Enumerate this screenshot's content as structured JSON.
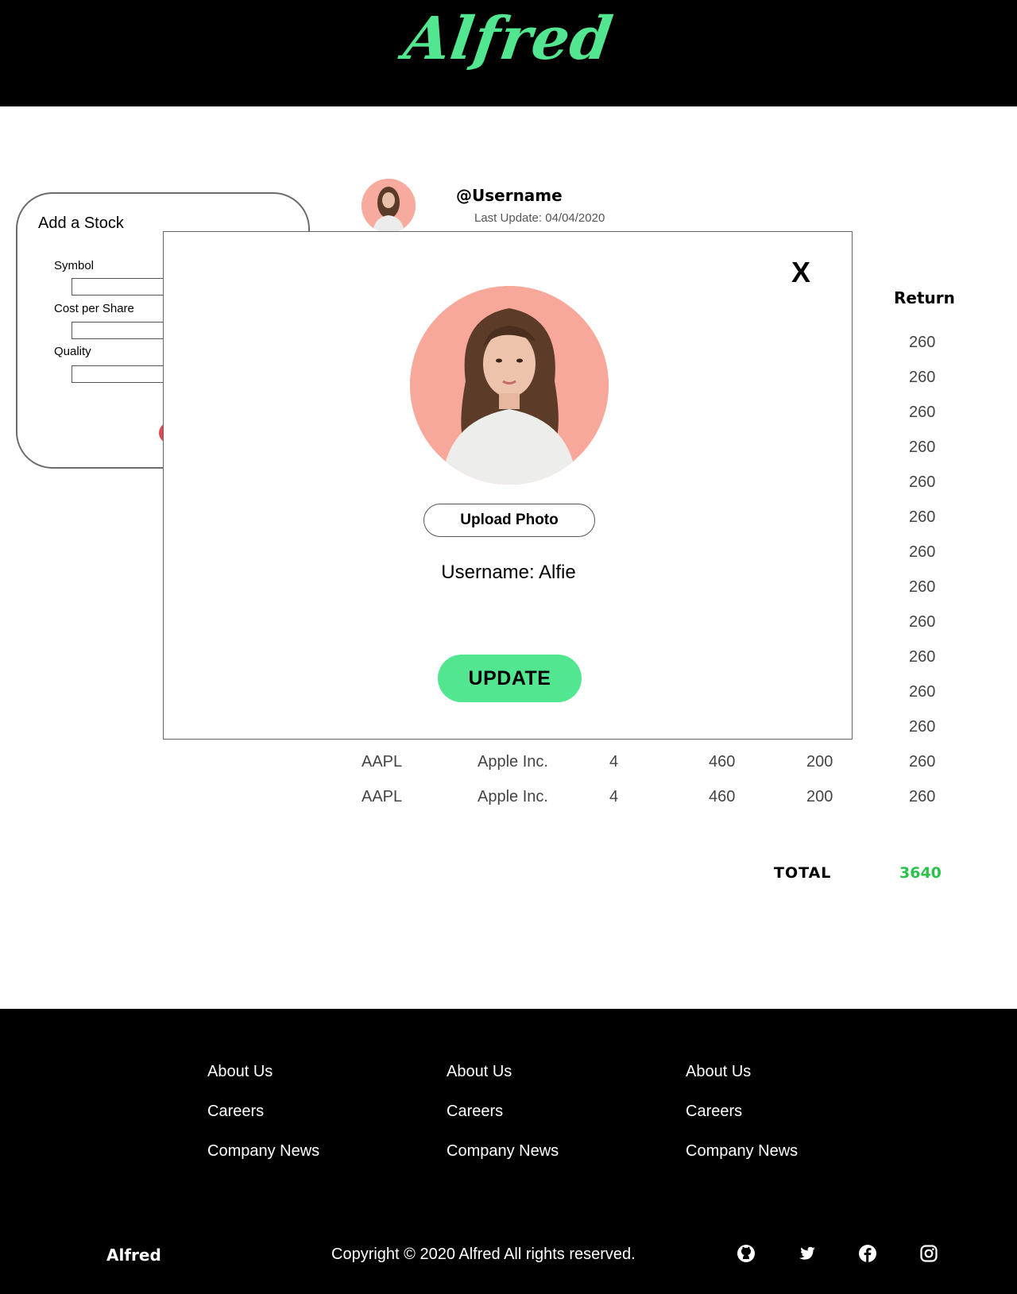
{
  "brand": {
    "logo": "Alfred",
    "accent": "#52e690"
  },
  "add_stock": {
    "title": "Add a Stock",
    "fields": [
      {
        "label": "Symbol",
        "value": ""
      },
      {
        "label": "Cost per Share",
        "value": ""
      },
      {
        "label": "Quality",
        "value": ""
      }
    ]
  },
  "profile": {
    "username": "@Username",
    "last_update": "Last Update: 04/04/2020"
  },
  "table": {
    "headers": {
      "return": "Return"
    },
    "hidden_returns": [
      "260",
      "260",
      "260",
      "260",
      "260",
      "260",
      "260",
      "260",
      "260",
      "260",
      "260",
      "260"
    ],
    "rows": [
      {
        "symbol": "AAPL",
        "name": "Apple Inc.",
        "shares": "4",
        "value": "460",
        "cost": "200",
        "return": "260"
      },
      {
        "symbol": "AAPL",
        "name": "Apple Inc.",
        "shares": "4",
        "value": "460",
        "cost": "200",
        "return": "260"
      }
    ],
    "total_label": "TOTAL",
    "total_value": "3640",
    "total_color": "#2cc24a"
  },
  "modal": {
    "close_label": "X",
    "upload_label": "Upload Photo",
    "username_text": "Username: Alfie",
    "update_label": "UPDATE"
  },
  "footer": {
    "columns": [
      [
        "About Us",
        "Careers",
        "Company News"
      ],
      [
        "About Us",
        "Careers",
        "Company News"
      ],
      [
        "About Us",
        "Careers",
        "Company News"
      ]
    ],
    "brand": "Alfred",
    "copyright": "Copyright © 2020 Alfred All rights reserved.",
    "social_icons": [
      "github-icon",
      "twitter-icon",
      "facebook-icon",
      "instagram-icon"
    ]
  }
}
